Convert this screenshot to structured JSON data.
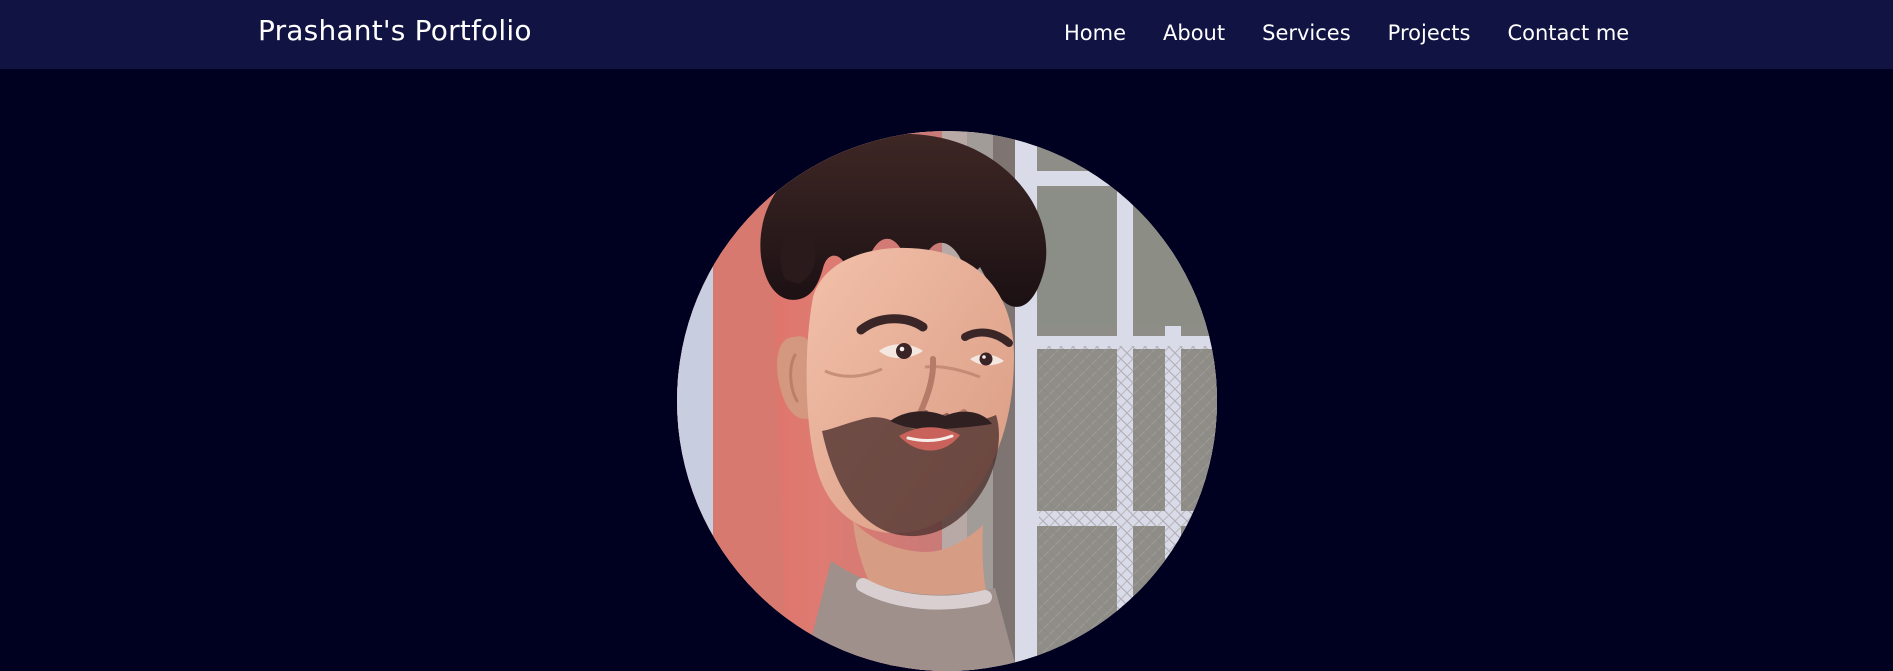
{
  "header": {
    "brand": "Prashant's Portfolio",
    "nav": [
      "Home",
      "About",
      "Services",
      "Projects",
      "Contact me"
    ]
  },
  "hero": {
    "photo_icon": "profile-photo",
    "colors": {
      "page_background": "#000021",
      "navbar_background": "#111443",
      "text": "#ffffff"
    }
  }
}
